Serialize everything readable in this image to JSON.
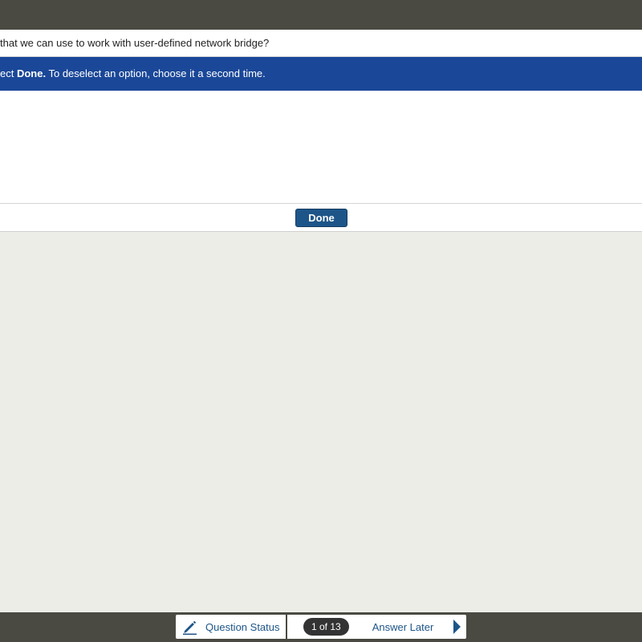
{
  "question": {
    "text": "that we can use to work with user-defined network bridge?"
  },
  "instruction": {
    "prefix": "ect ",
    "bold": "Done.",
    "suffix": " To deselect an option, choose it a second time."
  },
  "done": {
    "label": "Done"
  },
  "footer": {
    "status_label": "Question Status",
    "counter": "1 of 13",
    "later_label": "Answer Later"
  },
  "colors": {
    "top_bar": "#4a4a42",
    "instruction_bg": "#1a4798",
    "button_bg": "#1d5588",
    "link": "#1d5588",
    "content_bg": "#ededE8"
  },
  "icons": {
    "status": "pencil-icon",
    "next": "chevron-right-icon"
  }
}
